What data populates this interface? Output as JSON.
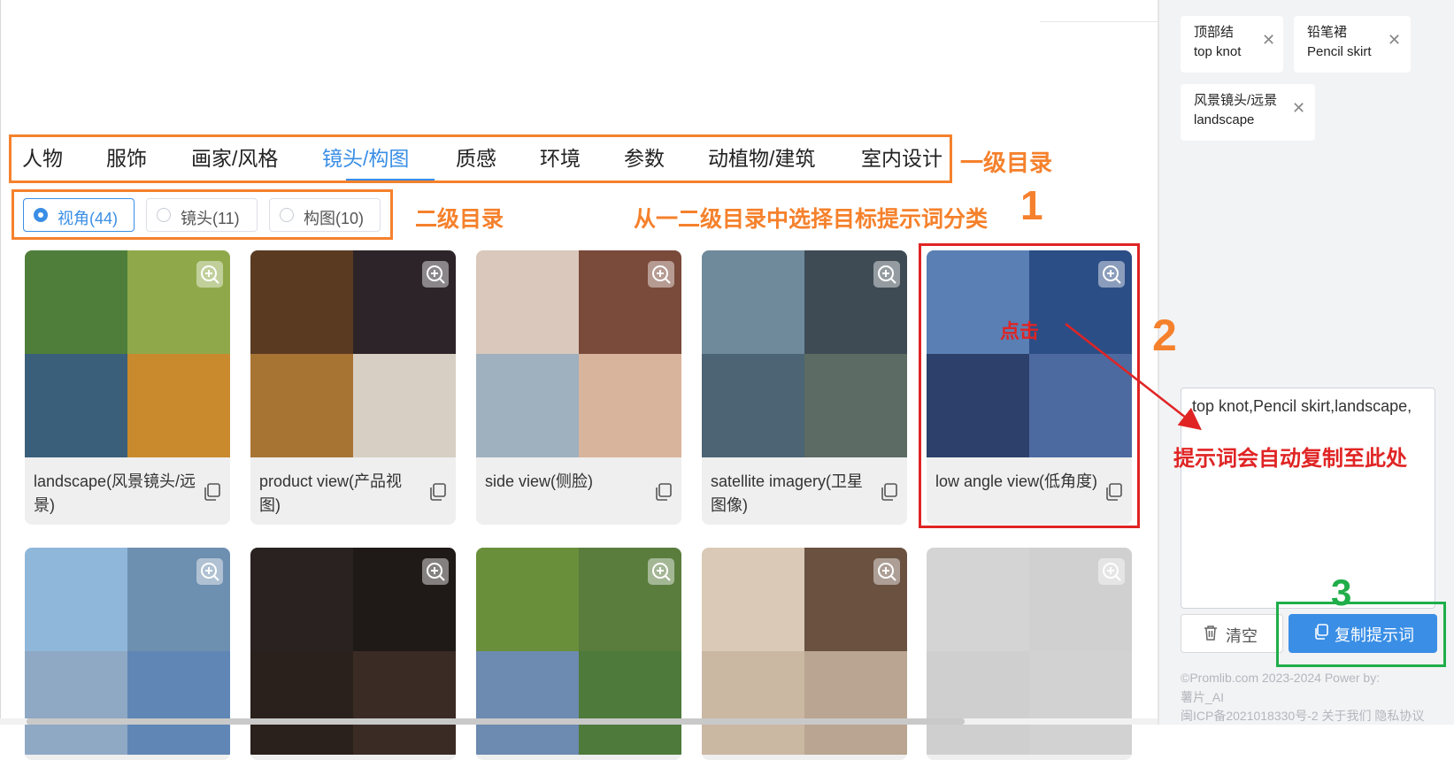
{
  "nav": {
    "items": [
      "人物",
      "服饰",
      "画家/风格",
      "镜头/构图",
      "质感",
      "环境",
      "参数",
      "动植物/建筑",
      "室内设计"
    ],
    "active_index": 3
  },
  "subnav": {
    "options": [
      "视角(44)",
      "镜头(11)",
      "构图(10)"
    ],
    "selected_index": 0
  },
  "cards": [
    {
      "title": "landscape(风景镜头/远景)",
      "colors": [
        "#4f7e3a",
        "#8fa94a",
        "#3a5f7a",
        "#c98a2e"
      ]
    },
    {
      "title": "product view(产品视图)",
      "colors": [
        "#5a3b22",
        "#2c2428",
        "#a87434",
        "#d7cfc3"
      ]
    },
    {
      "title": "side view(侧脸)",
      "colors": [
        "#d9c8bb",
        "#7a4a3a",
        "#9fb0bf",
        "#d9b49c"
      ]
    },
    {
      "title": "satellite imagery(卫星图像)",
      "colors": [
        "#6f8a9b",
        "#3e4b55",
        "#4c6474",
        "#5c6b63"
      ]
    },
    {
      "title": "low angle view(低角度)",
      "colors": [
        "#5a7fb4",
        "#2c4e86",
        "#2d3f6b",
        "#4d6aa0"
      ]
    },
    {
      "title": "",
      "colors": [
        "#8fb7d9",
        "#6d8fb0",
        "#8fa8c4",
        "#5f86b5"
      ]
    },
    {
      "title": "",
      "colors": [
        "#2a2220",
        "#1f1917",
        "#2a201c",
        "#3a2b25"
      ]
    },
    {
      "title": "",
      "colors": [
        "#6a8f3a",
        "#5a7d3e",
        "#6d8ab0",
        "#4e7a3c"
      ]
    },
    {
      "title": "",
      "colors": [
        "#d9c9b6",
        "#6a5140",
        "#cbb8a3",
        "#b9a591"
      ]
    },
    {
      "title": "",
      "colors": [
        "#d4d4d4",
        "#d0d0d0",
        "#cfcfcf",
        "#d2d2d2"
      ]
    }
  ],
  "tags": [
    {
      "zh": "顶部结",
      "en": "top knot"
    },
    {
      "zh": "铅笔裙",
      "en": "Pencil skirt"
    },
    {
      "zh": "风景镜头/远景",
      "en": "landscape"
    }
  ],
  "prompt": {
    "value": "top knot,Pencil skirt,landscape,"
  },
  "buttons": {
    "clear": "清空",
    "copy": "复制提示词"
  },
  "footer": {
    "line1": "©Promlib.com 2023-2024   Power by:",
    "line2": "薯片_AI",
    "line3": "闽ICP备2021018330号-2  关于我们  隐私协议"
  },
  "annotations": {
    "level1": "一级目录",
    "level2": "二级目录",
    "instruction": "从一二级目录中选择目标提示词分类",
    "step1": "1",
    "step2": "2",
    "step3": "3",
    "click": "点击",
    "auto_copy": "提示词会自动复制至此处"
  },
  "colors": {
    "accent": "#3a8ee6",
    "anno_orange": "#f5812c",
    "anno_red": "#e02424",
    "anno_green": "#1fae4a"
  }
}
